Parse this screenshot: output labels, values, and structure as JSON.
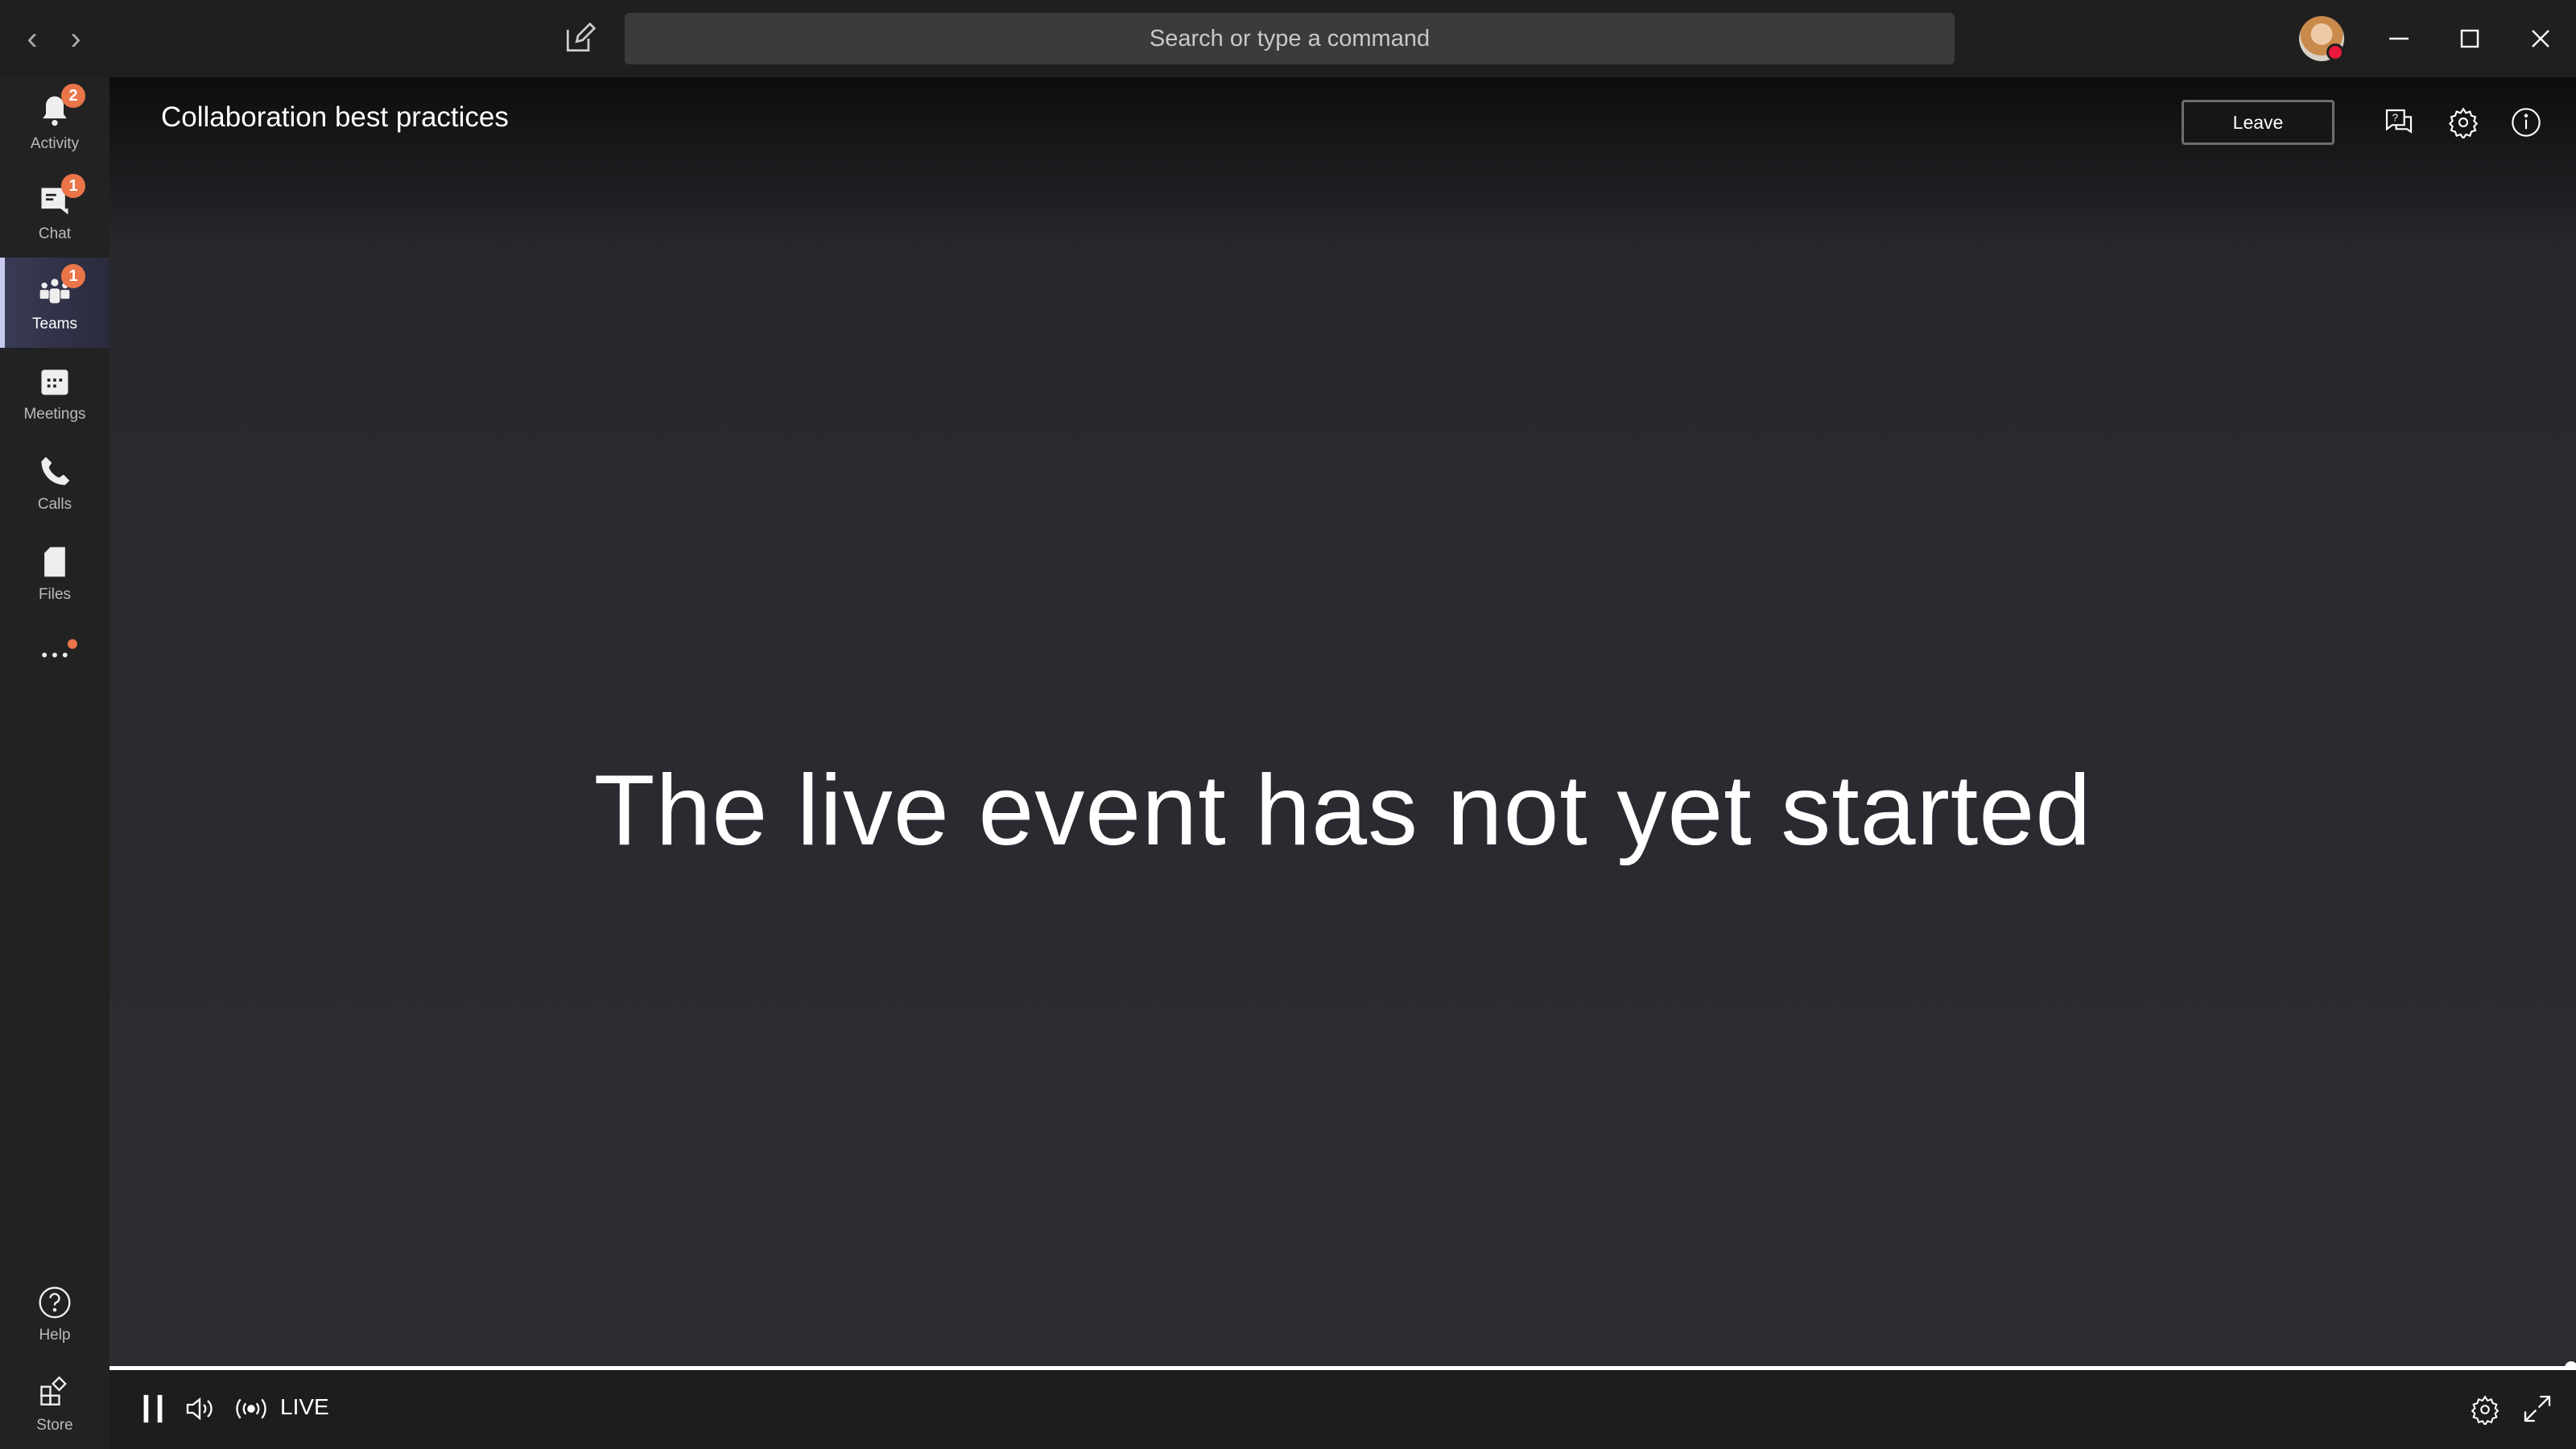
{
  "titlebar": {
    "search_placeholder": "Search or type a command",
    "back_icon": "chevron-left-icon",
    "forward_icon": "chevron-right-icon",
    "presence_color": "#e8193c"
  },
  "sidebar": {
    "items": [
      {
        "label": "Activity",
        "badge": "2"
      },
      {
        "label": "Chat",
        "badge": "1"
      },
      {
        "label": "Teams",
        "badge": "1",
        "active": true
      },
      {
        "label": "Meetings"
      },
      {
        "label": "Calls"
      },
      {
        "label": "Files"
      },
      {
        "label": "More apps",
        "has_dot": true
      }
    ],
    "bottom": [
      {
        "label": "Help"
      },
      {
        "label": "Store"
      }
    ],
    "badge_color": "#e97548"
  },
  "event": {
    "title": "Collaboration best practices",
    "leave_label": "Leave",
    "message": "The live event has not yet started"
  },
  "player": {
    "live_label": "LIVE",
    "progress": 1.0
  }
}
